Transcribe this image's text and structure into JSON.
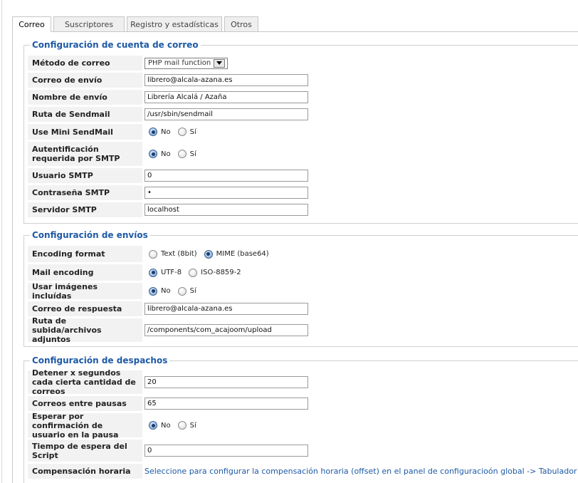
{
  "tabs": [
    {
      "label": "Correo",
      "active": true
    },
    {
      "label": "Suscriptores",
      "active": false
    },
    {
      "label": "Registro y estadísticas",
      "active": false
    },
    {
      "label": "Otros",
      "active": false
    }
  ],
  "section_account": {
    "title": "Configuración de cuenta de correo",
    "method_label": "Método de correo",
    "method_value": "PHP mail function",
    "sender_email_label": "Correo de envío",
    "sender_email_value": "librero@alcala-azana.es",
    "sender_name_label": "Nombre de envío",
    "sender_name_value": "Librería Alcalá / Azaña",
    "sendmail_path_label": "Ruta de Sendmail",
    "sendmail_path_value": "/usr/sbin/sendmail",
    "mini_sendmail_label": "Use Mini SendMail",
    "smtp_auth_label": "Autentificación requerida por SMTP",
    "smtp_user_label": "Usuario SMTP",
    "smtp_user_value": "0",
    "smtp_password_label": "Contraseña SMTP",
    "smtp_password_value": "•",
    "smtp_server_label": "Servidor SMTP",
    "smtp_server_value": "localhost"
  },
  "section_sending": {
    "title": "Configuración de envíos",
    "encoding_format_label": "Encoding format",
    "encoding_format_opt1": "Text (8bit)",
    "encoding_format_opt2": "MIME (base64)",
    "mail_encoding_label": "Mail encoding",
    "mail_encoding_opt1": "UTF-8",
    "mail_encoding_opt2": "ISO-8859-2",
    "embed_images_label": "Usar imágenes incluídas",
    "reply_to_label": "Correo de respuesta",
    "reply_to_value": "librero@alcala-azana.es",
    "upload_path_label": "Ruta de subida/archivos adjuntos",
    "upload_path_value": "/components/com_acajoom/upload"
  },
  "section_dispatch": {
    "title": "Configuración de despachos",
    "pause_seconds_label": "Detener x segundos cada cierta cantidad de correos",
    "pause_seconds_value": "20",
    "mails_between_label": "Correos entre pausas",
    "mails_between_value": "65",
    "wait_confirm_label": "Esperar por confirmación de usuario en la pausa",
    "script_timeout_label": "Tiempo de espera del Script",
    "script_timeout_value": "0",
    "time_offset_label": "Compensación horaria",
    "time_offset_link": "Seleccione para configurar la compensación horaria (offset) en el panel de configuracioón global -> Tabulador Local"
  },
  "radio": {
    "no": "No",
    "si": "Sí"
  }
}
